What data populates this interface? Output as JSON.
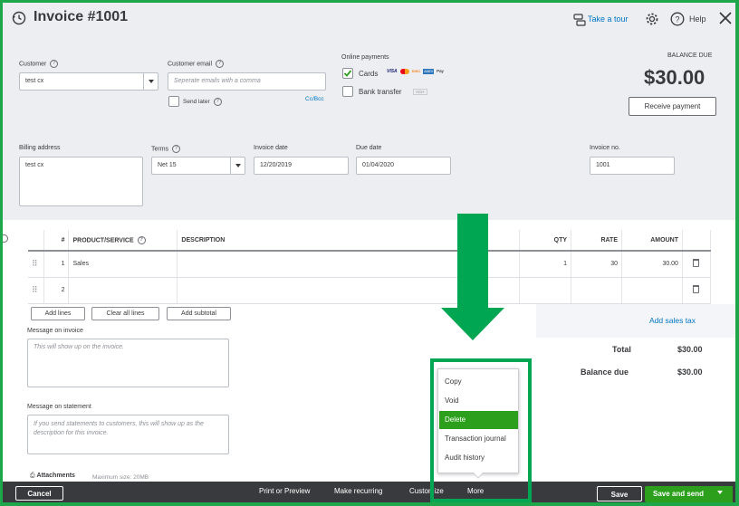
{
  "header": {
    "title": "Invoice #1001",
    "take_tour": "Take a tour",
    "help": "Help"
  },
  "customer": {
    "label": "Customer",
    "value": "test cx"
  },
  "customer_email": {
    "label": "Customer email",
    "placeholder": "Seperate emails with a comma",
    "send_later": "Send later",
    "cc_bcc": "Cc/Bcc"
  },
  "online_payments": {
    "label": "Online payments",
    "cards": "Cards",
    "cards_checked": true,
    "card_logos": [
      "VISA",
      "MC",
      "DISC",
      "AMEX",
      "Pay"
    ],
    "bank_transfer": "Bank transfer",
    "bank_logo": "ACH",
    "bank_checked": false
  },
  "balance": {
    "label": "BALANCE DUE",
    "amount": "$30.00",
    "receive_payment": "Receive payment"
  },
  "billing_address": {
    "label": "Billing address",
    "value": "test cx"
  },
  "terms": {
    "label": "Terms",
    "value": "Net 15"
  },
  "invoice_date": {
    "label": "Invoice date",
    "value": "12/20/2019"
  },
  "due_date": {
    "label": "Due date",
    "value": "01/04/2020"
  },
  "invoice_no": {
    "label": "Invoice no.",
    "value": "1001"
  },
  "table": {
    "headers": {
      "num": "#",
      "product": "PRODUCT/SERVICE",
      "description": "DESCRIPTION",
      "qty": "QTY",
      "rate": "RATE",
      "amount": "AMOUNT"
    },
    "rows": [
      {
        "num": "1",
        "product": "Sales",
        "description": "",
        "qty": "1",
        "rate": "30",
        "amount": "30.00"
      },
      {
        "num": "2",
        "product": "",
        "description": "",
        "qty": "",
        "rate": "",
        "amount": ""
      }
    ]
  },
  "line_buttons": {
    "add_lines": "Add lines",
    "clear_all": "Clear all lines",
    "add_subtotal": "Add subtotal"
  },
  "messages": {
    "invoice_label": "Message on invoice",
    "invoice_placeholder": "This will show up on the invoice.",
    "statement_label": "Message on statement",
    "statement_placeholder": "If you send statements to customers, this will show up as the description for this invoice."
  },
  "attachments": {
    "label": "Attachments",
    "max_size": "Maximum size: 20MB"
  },
  "totals": {
    "add_sales_tax": "Add sales tax",
    "total_label": "Total",
    "total_value": "$30.00",
    "balance_due_label": "Balance due",
    "balance_due_value": "$30.00"
  },
  "more_menu": {
    "items": [
      "Copy",
      "Void",
      "Delete",
      "Transaction journal",
      "Audit history"
    ],
    "active": "Delete"
  },
  "footer": {
    "cancel": "Cancel",
    "print_preview": "Print or Preview",
    "make_recurring": "Make recurring",
    "customize": "Customize",
    "more": "More",
    "save": "Save",
    "save_and_send": "Save and send"
  },
  "colors": {
    "annotation_green": "#00a651",
    "qb_green": "#2ca01c",
    "link_blue": "#0077c5",
    "footer_dark": "#393a3d"
  }
}
